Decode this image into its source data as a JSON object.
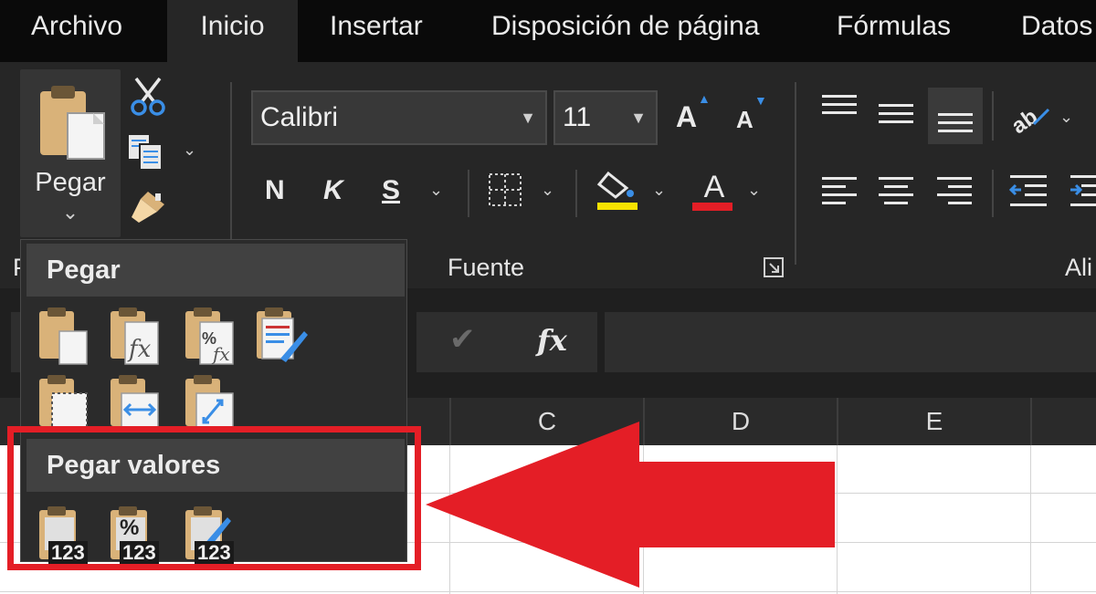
{
  "menu": {
    "tabs": [
      {
        "label": "Archivo"
      },
      {
        "label": "Inicio",
        "active": true
      },
      {
        "label": "Insertar"
      },
      {
        "label": "Disposición de página"
      },
      {
        "label": "Fórmulas"
      },
      {
        "label": "Datos"
      }
    ]
  },
  "ribbon": {
    "clipboard": {
      "paste_label": "Pegar",
      "paste_chevron": "⌄",
      "group_label_partial": "P"
    },
    "font": {
      "font_name": "Calibri",
      "font_size": "11",
      "bold": "N",
      "italic": "K",
      "underline": "S",
      "grow_label": "A",
      "shrink_label": "A",
      "font_color_label": "A",
      "fill_color": "#f7e300",
      "font_color": "#e41e26",
      "group_label": "Fuente"
    },
    "alignment": {
      "group_label_partial": "Ali"
    }
  },
  "formula_bar": {
    "fx_label": "fx",
    "check_icon": "✔"
  },
  "grid": {
    "columns": [
      "C",
      "D",
      "E"
    ]
  },
  "paste_menu": {
    "section1_title": "Pegar",
    "section2_title": "Pegar valores",
    "values_badge": "123",
    "percent_glyph": "%"
  },
  "annotation": {
    "highlight_color": "#e41e26"
  }
}
